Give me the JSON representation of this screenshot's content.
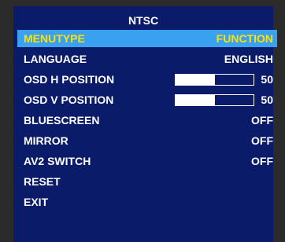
{
  "menu": {
    "title": "NTSC",
    "rows": [
      {
        "label": "MENUTYPE",
        "value": "FUNCTION",
        "selected": true
      },
      {
        "label": "LANGUAGE",
        "value": "ENGLISH"
      },
      {
        "label": "OSD H POSITION",
        "value": "50",
        "level": 0.5
      },
      {
        "label": "OSD V POSITION",
        "value": "50",
        "level": 0.5
      },
      {
        "label": "BLUESCREEN",
        "value": "OFF"
      },
      {
        "label": "MIRROR",
        "value": "OFF"
      },
      {
        "label": "AV2 SWITCH",
        "value": "OFF"
      },
      {
        "label": "RESET",
        "value": ""
      },
      {
        "label": "EXIT",
        "value": ""
      }
    ]
  },
  "colors": {
    "panel": "#0a1b69",
    "highlight": "#3aa0f0",
    "highlight_text": "#ffe100",
    "text": "#ffffff",
    "background": "#2b2b2b"
  }
}
